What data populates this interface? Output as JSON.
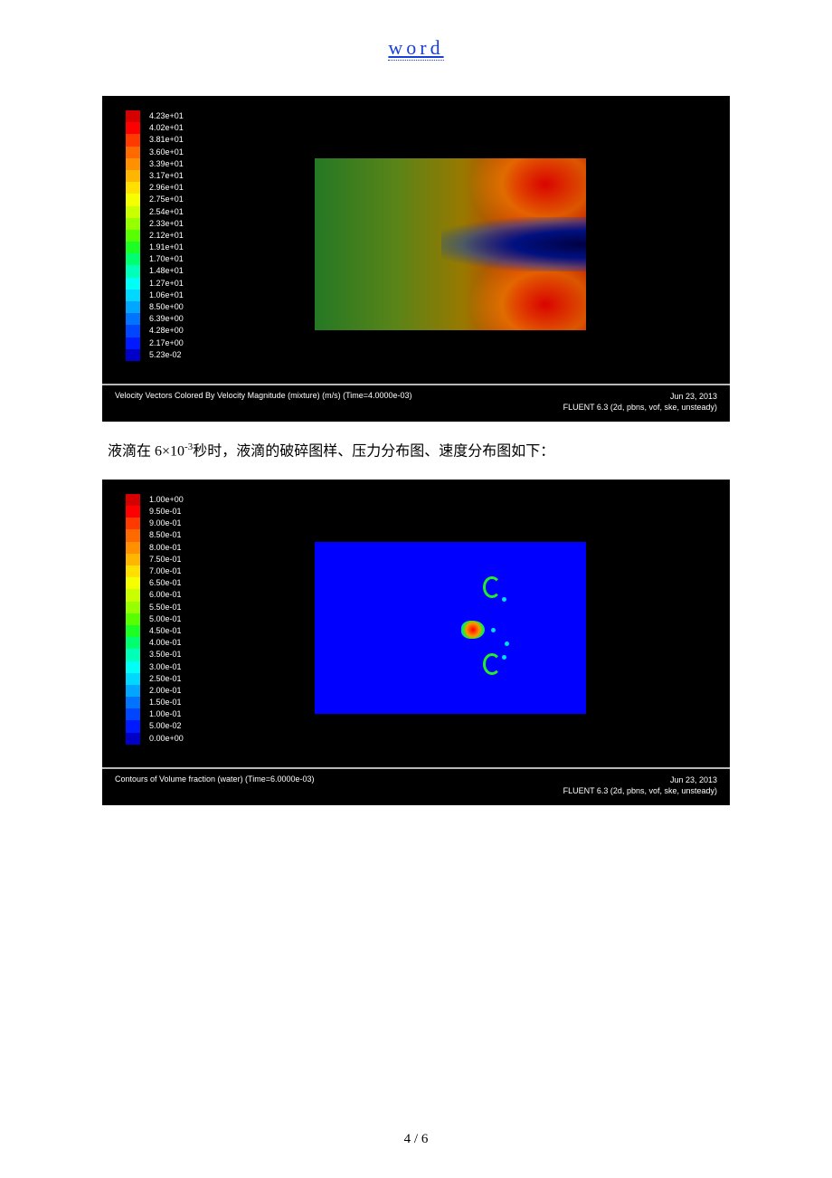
{
  "header": {
    "link_text": "word"
  },
  "figure1": {
    "legend_values": [
      "4.23e+01",
      "4.02e+01",
      "3.81e+01",
      "3.60e+01",
      "3.39e+01",
      "3.17e+01",
      "2.96e+01",
      "2.75e+01",
      "2.54e+01",
      "2.33e+01",
      "2.12e+01",
      "1.91e+01",
      "1.70e+01",
      "1.48e+01",
      "1.27e+01",
      "1.06e+01",
      "8.50e+00",
      "6.39e+00",
      "4.28e+00",
      "2.17e+00",
      "5.23e-02"
    ],
    "caption_left": "Velocity Vectors Colored By Velocity Magnitude (mixture)  (m/s)  (Time=4.0000e-03)",
    "caption_date": "Jun 23, 2013",
    "caption_solver": "FLUENT 6.3 (2d, pbns, vof, ske, unsteady)"
  },
  "paragraph1": {
    "prefix": "液滴在 6×10",
    "sup": "-3",
    "suffix": "秒时，液滴的破碎图样、压力分布图、速度分布图如下："
  },
  "figure2": {
    "legend_values": [
      "1.00e+00",
      "9.50e-01",
      "9.00e-01",
      "8.50e-01",
      "8.00e-01",
      "7.50e-01",
      "7.00e-01",
      "6.50e-01",
      "6.00e-01",
      "5.50e-01",
      "5.00e-01",
      "4.50e-01",
      "4.00e-01",
      "3.50e-01",
      "3.00e-01",
      "2.50e-01",
      "2.00e-01",
      "1.50e-01",
      "1.00e-01",
      "5.00e-02",
      "0.00e+00"
    ],
    "caption_left": "Contours of Volume fraction (water)   (Time=6.0000e-03)",
    "caption_date": "Jun 23, 2013",
    "caption_solver": "FLUENT 6.3 (2d, pbns, vof, ske, unsteady)"
  },
  "colorbar_colors": [
    "#d70000",
    "#ff0000",
    "#ff3a00",
    "#ff6a00",
    "#ff9100",
    "#ffb600",
    "#ffe000",
    "#f5ff00",
    "#caff00",
    "#96ff00",
    "#58ff00",
    "#1cff24",
    "#00ff70",
    "#00ffb8",
    "#00fff6",
    "#00d8ff",
    "#00a6ff",
    "#0074ff",
    "#0046ff",
    "#001aff",
    "#0000c8"
  ],
  "page_number": "4 / 6"
}
